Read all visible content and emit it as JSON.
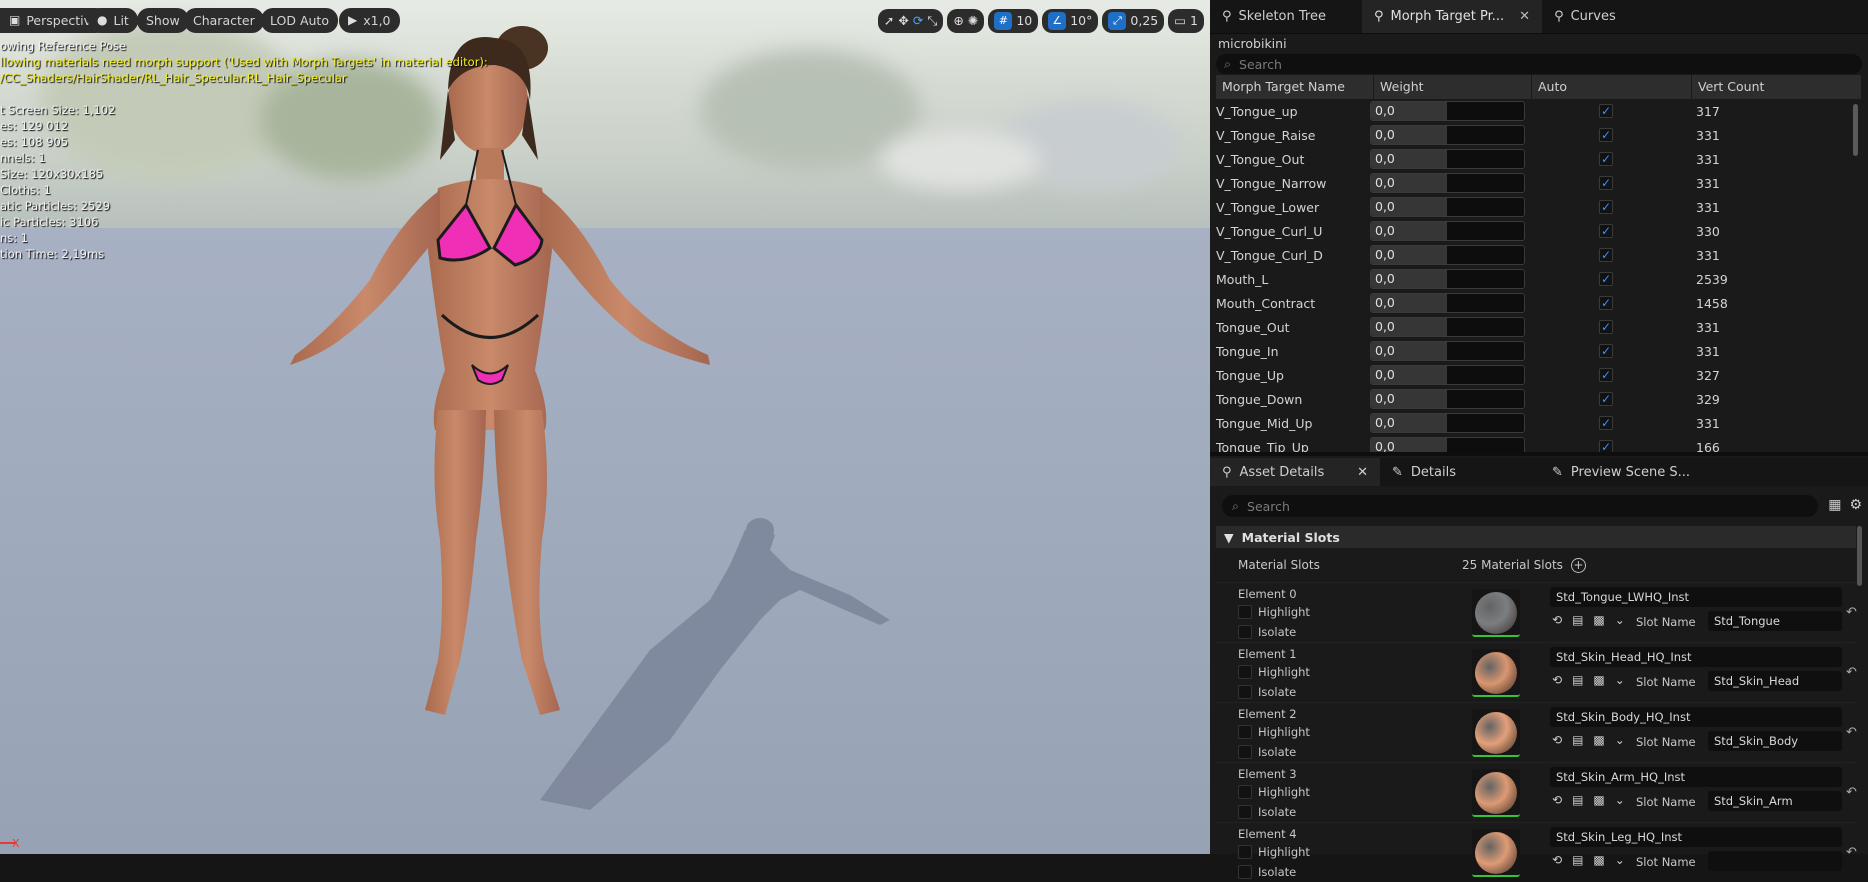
{
  "viewport": {
    "toolbar": {
      "perspective": "Perspective",
      "lit": "Lit",
      "show": "Show",
      "character": "Character",
      "lod": "LOD Auto",
      "speed": "x1,0",
      "grid_value": "10",
      "rotation_value": "10°",
      "scale_value": "0,25",
      "camera_value": "1"
    },
    "stats": {
      "line1": "owing Reference Pose",
      "warning": "llowing materials need morph support ('Used with Morph Targets' in material editor):",
      "material_path": "/CC_Shaders/HairShader/RL_Hair_Specular.RL_Hair_Specular",
      "screen_size": "t Screen Size: 1,102",
      "triangles": "es: 129 012",
      "vertices": "es: 108 905",
      "uv_channels": "nnels: 1",
      "approx_size": "Size: 120x30x185",
      "cloths": "Cloths: 1",
      "kinematic": "atic Particles: 2529",
      "dynamic": "ic Particles: 3106",
      "sections": "ns: 1",
      "sim_time": "tion Time: 2,19ms"
    },
    "axis_label": "X"
  },
  "panel_tabs": {
    "skeleton": "Skeleton Tree",
    "morph": "Morph Target Pr...",
    "curves": "Curves"
  },
  "morph": {
    "mesh_name": "microbikini",
    "search_placeholder": "Search",
    "columns": [
      "Morph Target Name",
      "Weight",
      "Auto",
      "Vert Count"
    ],
    "rows": [
      {
        "name": "V_Tongue_up",
        "weight": "0,0",
        "count": "317"
      },
      {
        "name": "V_Tongue_Raise",
        "weight": "0,0",
        "count": "331"
      },
      {
        "name": "V_Tongue_Out",
        "weight": "0,0",
        "count": "331"
      },
      {
        "name": "V_Tongue_Narrow",
        "weight": "0,0",
        "count": "331"
      },
      {
        "name": "V_Tongue_Lower",
        "weight": "0,0",
        "count": "331"
      },
      {
        "name": "V_Tongue_Curl_U",
        "weight": "0,0",
        "count": "330"
      },
      {
        "name": "V_Tongue_Curl_D",
        "weight": "0,0",
        "count": "331"
      },
      {
        "name": "Mouth_L",
        "weight": "0,0",
        "count": "2539"
      },
      {
        "name": "Mouth_Contract",
        "weight": "0,0",
        "count": "1458"
      },
      {
        "name": "Tongue_Out",
        "weight": "0,0",
        "count": "331"
      },
      {
        "name": "Tongue_In",
        "weight": "0,0",
        "count": "331"
      },
      {
        "name": "Tongue_Up",
        "weight": "0,0",
        "count": "327"
      },
      {
        "name": "Tongue_Down",
        "weight": "0,0",
        "count": "329"
      },
      {
        "name": "Tongue_Mid_Up",
        "weight": "0,0",
        "count": "331"
      },
      {
        "name": "Tongue_Tip_Up",
        "weight": "0,0",
        "count": "166"
      }
    ]
  },
  "details": {
    "tabs": {
      "asset": "Asset Details",
      "details": "Details",
      "preview": "Preview Scene S..."
    },
    "search_placeholder": "Search",
    "category": "Material Slots",
    "slots_label": "Material Slots",
    "slots_count": "25 Material Slots",
    "highlight": "Highlight",
    "isolate": "Isolate",
    "slot_name_label": "Slot Name",
    "elements": [
      {
        "label": "Element 0",
        "material": "Std_Tongue_LWHQ_Inst",
        "slot": "Std_Tongue",
        "color": "#7b7f82"
      },
      {
        "label": "Element 1",
        "material": "Std_Skin_Head_HQ_Inst",
        "slot": "Std_Skin_Head",
        "color": "#d99670"
      },
      {
        "label": "Element 2",
        "material": "Std_Skin_Body_HQ_Inst",
        "slot": "Std_Skin_Body",
        "color": "#e3a07a"
      },
      {
        "label": "Element 3",
        "material": "Std_Skin_Arm_HQ_Inst",
        "slot": "Std_Skin_Arm",
        "color": "#dd9a74"
      },
      {
        "label": "Element 4",
        "material": "Std_Skin_Leg_HQ_Inst",
        "slot": "",
        "color": "#de9b75"
      }
    ]
  }
}
